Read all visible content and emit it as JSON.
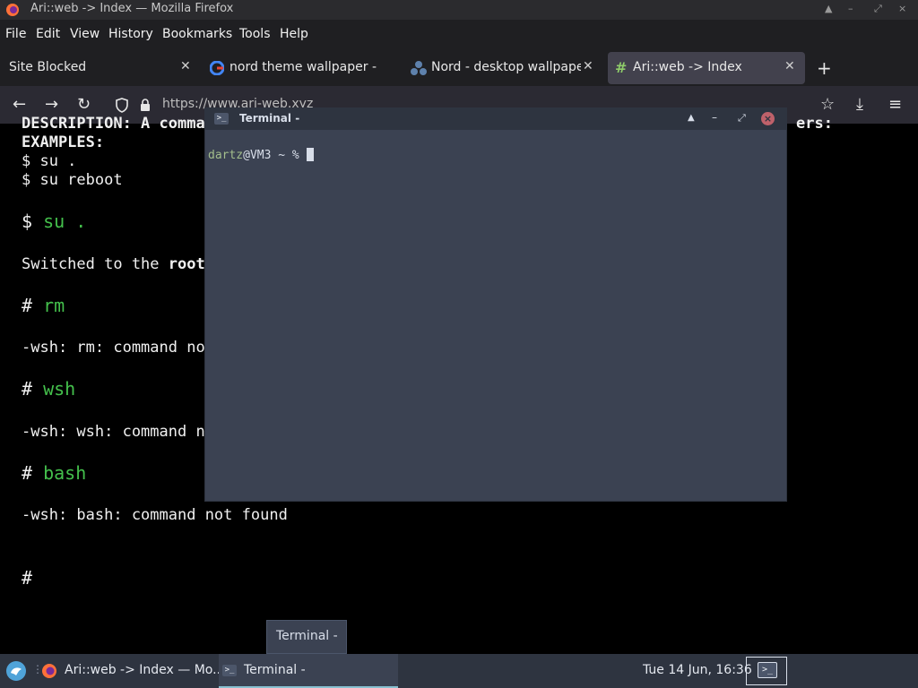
{
  "window": {
    "title": "Ari::web -> Index — Mozilla Firefox"
  },
  "menu": [
    "File",
    "Edit",
    "View",
    "History",
    "Bookmarks",
    "Tools",
    "Help"
  ],
  "tabs": [
    {
      "label": "Site Blocked",
      "icon": "none"
    },
    {
      "label": "nord theme wallpaper - G",
      "icon": "google-icon"
    },
    {
      "label": "Nord - desktop wallpaper",
      "icon": "nord-icon"
    },
    {
      "label": "Ari::web -> Index",
      "icon": "hash-icon",
      "active": true
    }
  ],
  "nav": {
    "url": "https://www.ari-web.xyz"
  },
  "page": {
    "lines": [
      {
        "text": "DESCRIPTION: A comma",
        "tail": "ers:"
      },
      {
        "text": "EXAMPLES:"
      },
      {
        "text": "$ su ."
      },
      {
        "text": "$ su reboot"
      },
      {
        "prompt": "$",
        "cmd": "su ."
      },
      {
        "text": "Switched to the ",
        "bold": "root"
      },
      {
        "prompt": "#",
        "cmd": "rm"
      },
      {
        "text": "-wsh: rm: command no"
      },
      {
        "prompt": "#",
        "cmd": "wsh"
      },
      {
        "text": "-wsh: wsh: command n"
      },
      {
        "prompt": "#",
        "cmd": "bash"
      },
      {
        "text": "-wsh: bash: command not found"
      },
      {
        "prompt": "#",
        "cmd": ""
      }
    ]
  },
  "terminal": {
    "title": "Terminal -",
    "user": "dartz",
    "host": "@VM3",
    "prompt_suffix": " ~ % "
  },
  "tooltip": {
    "text": "Terminal -"
  },
  "taskbar": {
    "firefox_label": "Ari::web -> Index — Mo...",
    "terminal_label": "Terminal -",
    "clock": "Tue 14 Jun, 16:36"
  },
  "colors": {
    "accent": "#88c0d0",
    "prompt_green": "#44c04c",
    "terminal_bg": "#3b4252"
  }
}
